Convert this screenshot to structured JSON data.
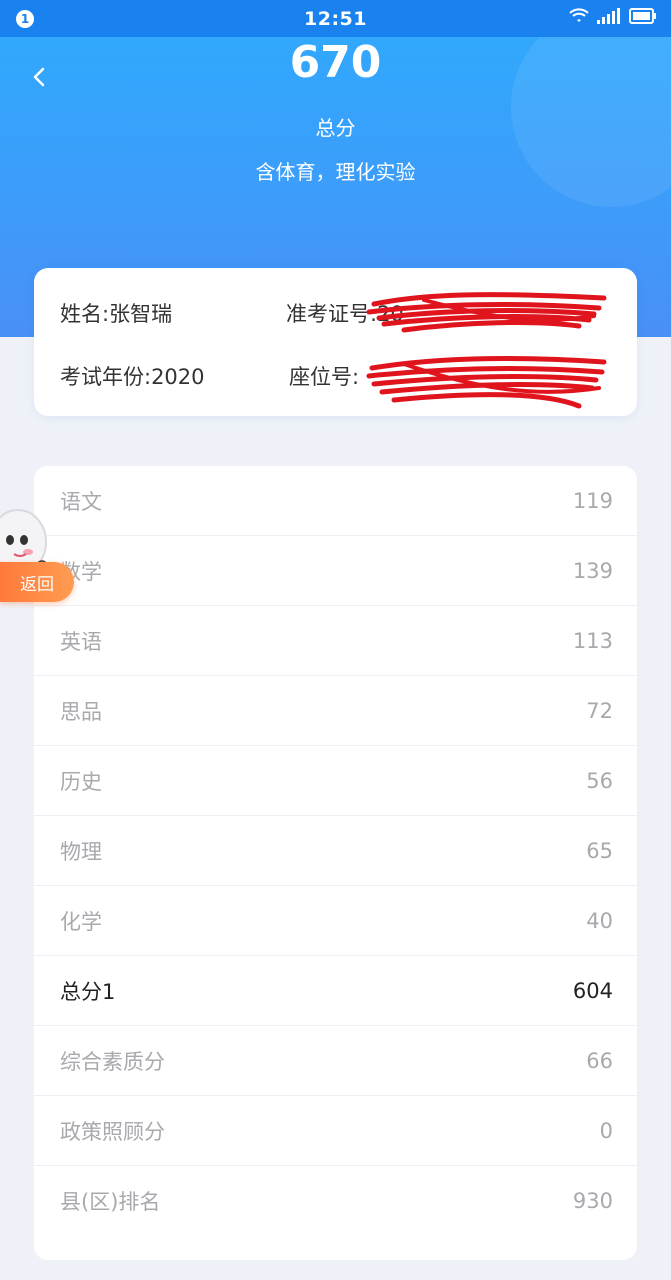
{
  "status_bar": {
    "notification_count": "1",
    "time": "12:51",
    "icons": [
      "wifi-icon",
      "signal-icon",
      "battery-icon"
    ]
  },
  "header": {
    "back_icon": "chevron-left-icon",
    "total_score": "670",
    "total_label": "总分",
    "note": "含体育，理化实验"
  },
  "info": {
    "name": "姓名:张智瑞",
    "exam_id_label": "准考证号:20",
    "exam_year": "考试年份:2020",
    "seat_label": "座位号:"
  },
  "scores": [
    {
      "subject": "语文",
      "score": "119"
    },
    {
      "subject": "数学",
      "score": "139"
    },
    {
      "subject": "英语",
      "score": "113"
    },
    {
      "subject": "思品",
      "score": "72"
    },
    {
      "subject": "历史",
      "score": "56"
    },
    {
      "subject": "物理",
      "score": "65"
    },
    {
      "subject": "化学",
      "score": "40"
    },
    {
      "subject": "总分1",
      "score": "604"
    },
    {
      "subject": "综合素质分",
      "score": "66"
    },
    {
      "subject": "政策照顾分",
      "score": "0"
    },
    {
      "subject": "县(区)排名",
      "score": "930"
    }
  ],
  "floating": {
    "return_label": "返回"
  },
  "colors": {
    "primary": "#3d9cfa",
    "background": "#eef2f8",
    "accent_orange": "#ff8a46",
    "redaction": "#e0141c"
  }
}
